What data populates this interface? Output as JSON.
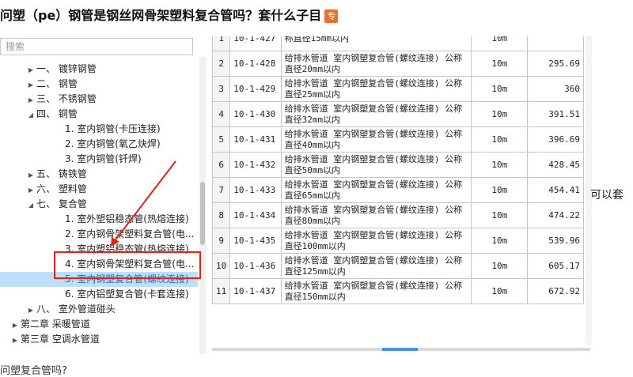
{
  "page": {
    "title": "问塑（pe）钢管是钢丝网骨架塑料复合管吗？套什么子目",
    "badge": "专",
    "side_text": "可以套",
    "bottom_text": "问塑复合管吗?"
  },
  "search": {
    "placeholder": "搜索"
  },
  "tree": [
    {
      "label": "一、 镀锌钢管",
      "arrow": "▶"
    },
    {
      "label": "二、 钢管",
      "arrow": "▶"
    },
    {
      "label": "三、 不锈钢管",
      "arrow": "▶"
    },
    {
      "label": "四、 铜管",
      "arrow": "◢"
    },
    {
      "label": "1. 室内铜管(卡压连接)",
      "arrow": ""
    },
    {
      "label": "2. 室内铜管(氧乙炔焊)",
      "arrow": ""
    },
    {
      "label": "3. 室内铜管(钎焊)",
      "arrow": ""
    },
    {
      "label": "五、 铸铁管",
      "arrow": "▶"
    },
    {
      "label": "六、 塑料管",
      "arrow": "▶"
    },
    {
      "label": "七、 复合管",
      "arrow": "◢"
    },
    {
      "label": "1. 室外塑铝稳态管(热熔连接)",
      "arrow": ""
    },
    {
      "label": "2. 室内钢骨架塑料复合管(电...",
      "arrow": ""
    },
    {
      "label": "3. 室内塑铝稳态管(热熔连接)",
      "arrow": ""
    },
    {
      "label": "4. 室内钢骨架塑料复合管(电...",
      "arrow": ""
    },
    {
      "label": "5. 室内钢塑复合管(螺纹连接)",
      "arrow": ""
    },
    {
      "label": "6. 室内铝塑复合管(卡套连接)",
      "arrow": ""
    },
    {
      "label": "八、 室外管道碰头",
      "arrow": "▶"
    },
    {
      "label": "第二章 采暖管道",
      "arrow": "▶"
    },
    {
      "label": "第三章 空调水管道",
      "arrow": "▶"
    }
  ],
  "table": {
    "rows": [
      {
        "no": "1",
        "code": "10-1-427",
        "name": "称直径15mm以内",
        "unit": "10m",
        "price": ""
      },
      {
        "no": "2",
        "code": "10-1-428",
        "name": "给排水管道 室内钢塑复合管(螺纹连接) 公称直径20mm以内",
        "unit": "10m",
        "price": "295.69"
      },
      {
        "no": "3",
        "code": "10-1-429",
        "name": "给排水管道 室内钢塑复合管(螺纹连接) 公称直径25mm以内",
        "unit": "10m",
        "price": "360"
      },
      {
        "no": "4",
        "code": "10-1-430",
        "name": "给排水管道 室内钢塑复合管(螺纹连接) 公称直径32mm以内",
        "unit": "10m",
        "price": "391.51"
      },
      {
        "no": "5",
        "code": "10-1-431",
        "name": "给排水管道 室内钢塑复合管(螺纹连接) 公称直径40mm以内",
        "unit": "10m",
        "price": "396.69"
      },
      {
        "no": "6",
        "code": "10-1-432",
        "name": "给排水管道 室内钢塑复合管(螺纹连接) 公称直径50mm以内",
        "unit": "10m",
        "price": "428.45"
      },
      {
        "no": "7",
        "code": "10-1-433",
        "name": "给排水管道 室内钢塑复合管(螺纹连接) 公称直径65mm以内",
        "unit": "10m",
        "price": "454.41"
      },
      {
        "no": "8",
        "code": "10-1-434",
        "name": "给排水管道 室内钢塑复合管(螺纹连接) 公称直径80mm以内",
        "unit": "10m",
        "price": "474.22"
      },
      {
        "no": "9",
        "code": "10-1-435",
        "name": "给排水管道 室内钢塑复合管(螺纹连接) 公称直径100mm以内",
        "unit": "10m",
        "price": "539.96"
      },
      {
        "no": "10",
        "code": "10-1-436",
        "name": "给排水管道 室内钢塑复合管(螺纹连接) 公称直径125mm以内",
        "unit": "10m",
        "price": "605.17"
      },
      {
        "no": "11",
        "code": "10-1-437",
        "name": "给排水管道 室内钢塑复合管(螺纹连接) 公称直径150mm以内",
        "unit": "10m",
        "price": "672.92"
      }
    ]
  },
  "colors": {
    "annotation": "#e0241a",
    "selection": "#bde0ff",
    "badge": "#f26b2a"
  }
}
